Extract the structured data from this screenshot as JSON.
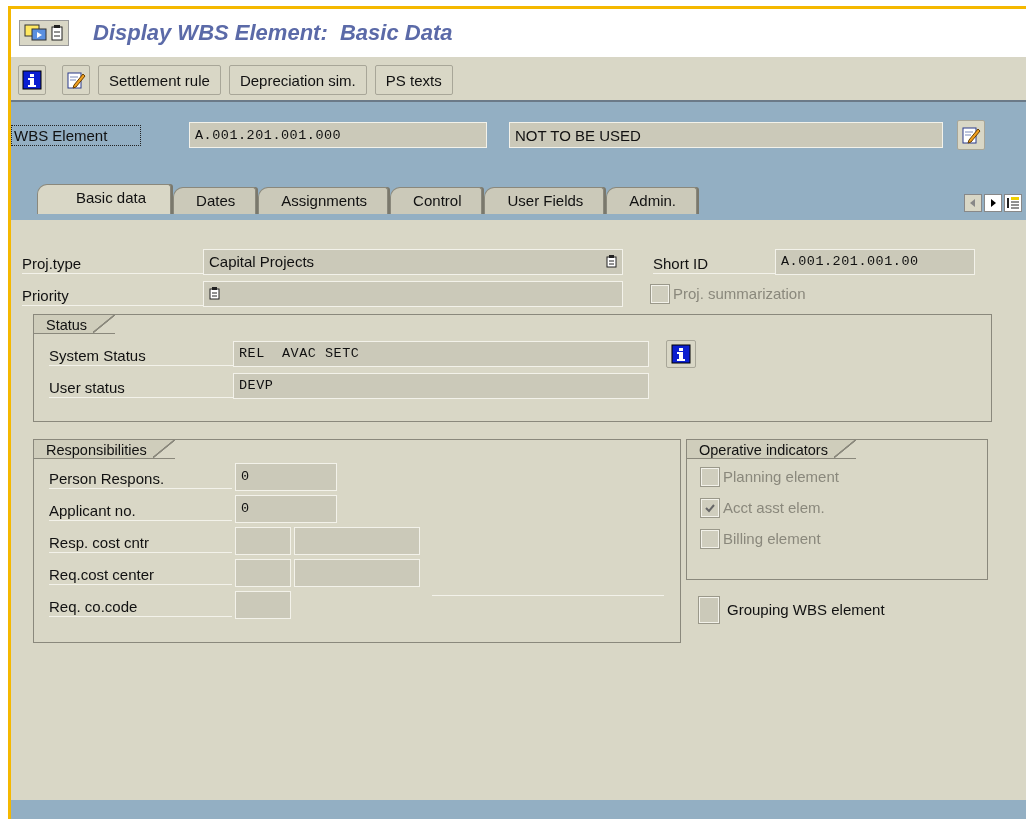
{
  "window": {
    "title": "Display WBS Element:  Basic Data"
  },
  "toolbar": {
    "buttons": [
      "Settlement rule",
      "Depreciation sim.",
      "PS texts"
    ]
  },
  "header": {
    "label": "WBS Element",
    "value": "A.001.201.001.000",
    "description": "NOT TO BE USED"
  },
  "tabs": [
    {
      "label": "Basic data",
      "selected": true
    },
    {
      "label": "Dates",
      "selected": false
    },
    {
      "label": "Assignments",
      "selected": false
    },
    {
      "label": "Control",
      "selected": false
    },
    {
      "label": "User Fields",
      "selected": false
    },
    {
      "label": "Admin.",
      "selected": false
    }
  ],
  "basic": {
    "fields": [
      {
        "label": "Proj.type",
        "value": "Capital Projects"
      },
      {
        "label": "Priority"
      }
    ],
    "short_id": {
      "label": "Short ID",
      "value": "A.001.201.001.00"
    },
    "proj_summarization": {
      "label": "Proj. summarization",
      "checked": false,
      "disabled": true
    }
  },
  "status": {
    "title": "Status",
    "rows": [
      {
        "label": "System Status",
        "value": "REL  AVAC SETC"
      },
      {
        "label": "User status",
        "value": "DEVP"
      }
    ]
  },
  "responsibilities": {
    "title": "Responsibilities",
    "rows": [
      {
        "label": "Person Respons.",
        "kind": "wide",
        "value": "0"
      },
      {
        "label": "Applicant no.",
        "kind": "wide",
        "value": "0"
      },
      {
        "label": "Resp. cost cntr",
        "kind": "pair"
      },
      {
        "label": "Req.cost center",
        "kind": "pair"
      },
      {
        "label": "Req. co.code",
        "kind": "short"
      }
    ]
  },
  "operative_indicators": {
    "title": "Operative indicators",
    "items": [
      {
        "label": "Planning element",
        "checked": false,
        "disabled": true
      },
      {
        "label": "Acct asst elem.",
        "checked": true,
        "disabled": true
      },
      {
        "label": "Billing element",
        "checked": false,
        "disabled": true
      }
    ]
  },
  "grouping": {
    "label": "Grouping WBS element",
    "checked": false,
    "disabled": false
  }
}
